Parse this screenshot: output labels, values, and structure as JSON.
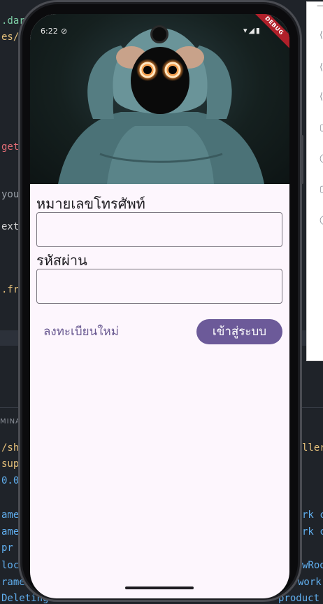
{
  "ide": {
    "code_lines": [
      {
        "text": ".dart",
        "color": "#7fd0a8"
      },
      {
        "text": "es/i",
        "color": "#e5c07b"
      },
      {
        "text": "get",
        "color": "#e06c75"
      },
      {
        "text": "you",
        "color": "#9aa0a8"
      },
      {
        "text": "ext",
        "color": "#d7d7d7"
      },
      {
        "text": ".fr",
        "color": "#e5c07b"
      }
    ],
    "panel_label": "MINA",
    "terminal_lines": [
      {
        "left": "/sh",
        "right": "ller",
        "color": "#e5c07b"
      },
      {
        "left": "sup",
        "right": "",
        "color": "#e5c07b"
      },
      {
        "left": "0.0",
        "right": "",
        "color": "#61afef"
      },
      {
        "left": "ame",
        "right": "rk c",
        "color": "#61afef"
      },
      {
        "left": "ame",
        "right": "rk c",
        "color": "#61afef"
      },
      {
        "left": " pr",
        "right": "",
        "color": "#61afef"
      },
      {
        "left": "loc",
        "right": "wRoo",
        "color": "#61afef"
      },
      {
        "left": "rame",
        "right": "work",
        "color": "#61afef"
      },
      {
        "left": "Deleting",
        "right": "product",
        "color": "#61afef"
      }
    ],
    "right_window_glyphs": [
      "—",
      "⟨",
      "⟨",
      "⟨",
      "▢",
      "◯",
      "▢",
      "◯"
    ]
  },
  "status_bar": {
    "time": "6:22",
    "icons": "▾◢▮",
    "dnd_icon": "⊘"
  },
  "debug_banner": "DEBUG",
  "form": {
    "phone_label": "หมายเลขโทรศัพท์",
    "phone_value": "",
    "password_label": "รหัสผ่าน",
    "password_value": "",
    "register_link": "ลงทะเบียนใหม่",
    "login_button": "เข้าสู่ระบบ"
  },
  "colors": {
    "primary": "#6c5a99",
    "background": "#fdf6fd",
    "link": "#6a5a92"
  }
}
